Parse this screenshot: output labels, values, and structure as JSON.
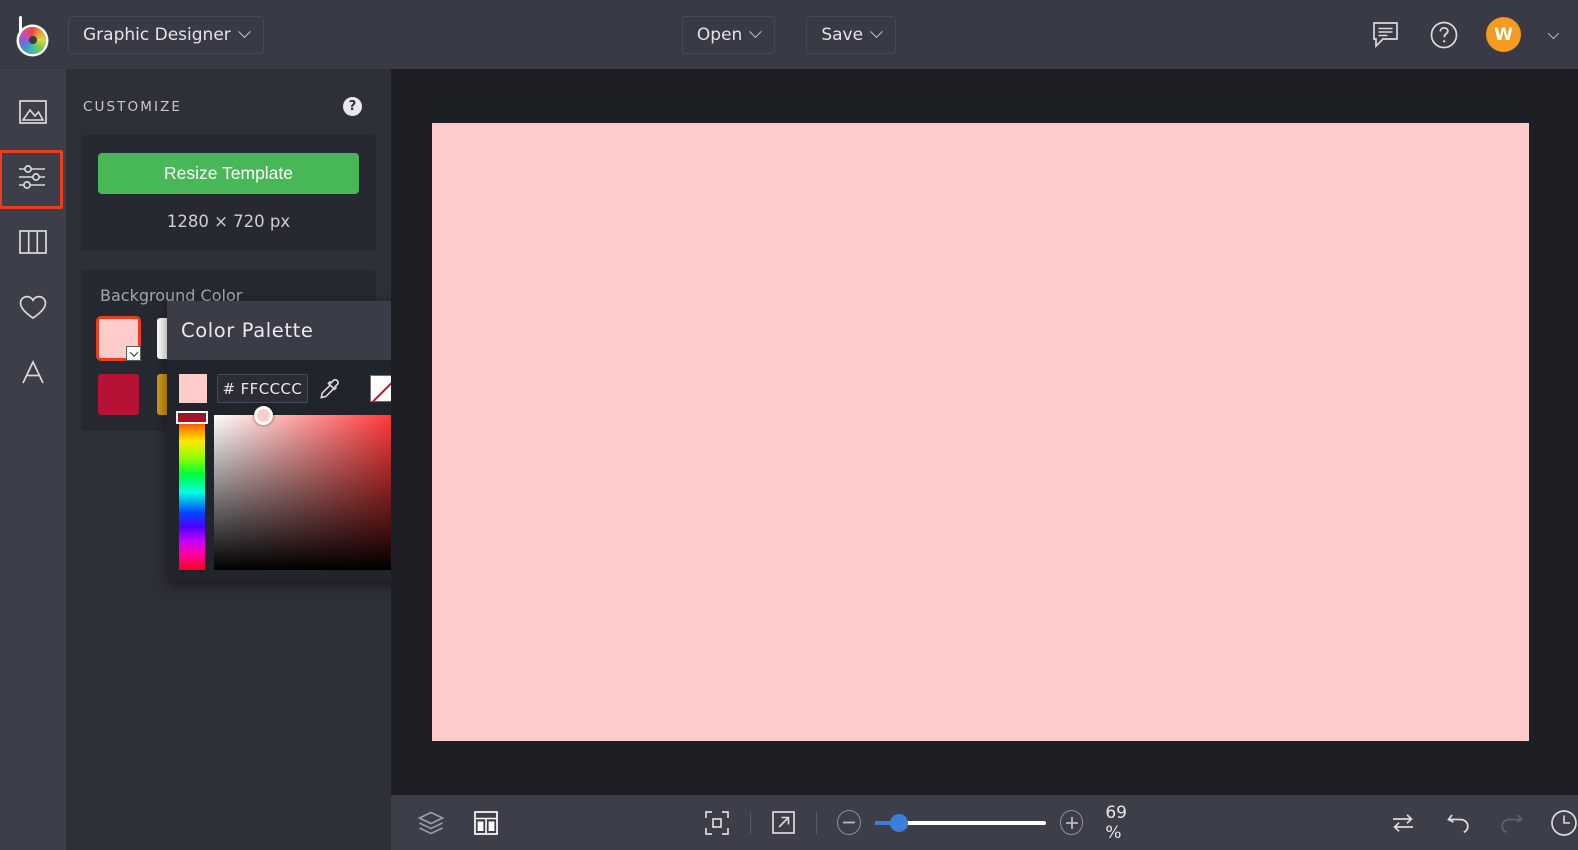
{
  "app": {
    "logo_icon": "rainbow-b-logo",
    "project_name": "Graphic Designer",
    "open_label": "Open",
    "save_label": "Save",
    "comment_icon": "comment-bubble-icon",
    "help_icon": "help-circle-icon",
    "avatar_initial": "W",
    "avatar_color": "#F39C1F"
  },
  "rail": {
    "items": [
      {
        "name": "image-tool",
        "icon": "image-icon",
        "selected": false
      },
      {
        "name": "adjust-tool",
        "icon": "sliders-icon",
        "selected": true
      },
      {
        "name": "layout-tool",
        "icon": "columns-icon",
        "selected": false
      },
      {
        "name": "favorites-tool",
        "icon": "heart-icon",
        "selected": false
      },
      {
        "name": "text-tool",
        "icon": "text-a-icon",
        "selected": false
      }
    ],
    "selection_highlight_color": "#EE3D1B"
  },
  "panel": {
    "title": "CUSTOMIZE",
    "help_icon": "help-circle-icon",
    "resize_button": "Resize Template",
    "resize_button_color": "#47B757",
    "dimensions": "1280 × 720 px",
    "background_color_label": "Background Color",
    "swatches": [
      {
        "hex": "#FFCCCC",
        "selected": true,
        "has_dropdown": true
      },
      {
        "hex": "#FFFFFF",
        "selected": false,
        "has_dropdown": false
      },
      {
        "hex": "#B51236",
        "selected": false,
        "has_dropdown": false
      },
      {
        "hex": "#D19A18",
        "selected": false,
        "has_dropdown": false
      }
    ]
  },
  "popup": {
    "title": "Color Palette",
    "hex_value": "# FFCCCC",
    "swatch_color": "#FFCCCC",
    "eyedropper_icon": "eyedropper-icon",
    "transparent_icon": "no-color-icon",
    "rainbow_icon": "color-wheel-icon",
    "hue_position_pct": 0,
    "sv_cursor_color": "#FFCCCC"
  },
  "canvas": {
    "background_color": "#FFCCCC",
    "stage_color": "#1E1F25"
  },
  "bottombar": {
    "layers_icon": "layers-icon",
    "panels_icon": "panels-icon",
    "fit_icon": "fit-to-screen-icon",
    "expand_icon": "expand-arrow-icon",
    "zoom_out_icon": "minus-icon",
    "zoom_in_icon": "plus-icon",
    "zoom_level": "69 %",
    "zoom_slider_value_pct": 13,
    "swap_icon": "swap-arrows-icon",
    "undo_icon": "undo-icon",
    "redo_icon": "redo-icon",
    "redo_disabled": true,
    "history_icon": "history-clock-icon"
  }
}
